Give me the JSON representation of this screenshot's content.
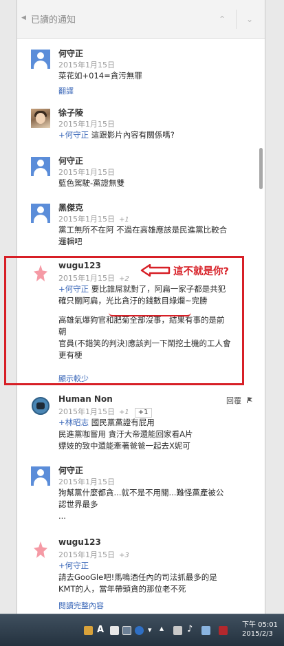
{
  "header": {
    "title": "已讀的通知"
  },
  "comments": [
    {
      "name": "何守正",
      "date": "2015年1月15日",
      "votes": "",
      "lines": [
        "菜花如+014=貪污無罪"
      ],
      "link": "翻譯"
    },
    {
      "name": "徐子陵",
      "date": "2015年1月15日",
      "mention": "+何守正",
      "lines": [
        "這跟影片內容有關係嗎?"
      ]
    },
    {
      "name": "何守正",
      "date": "2015年1月15日",
      "lines": [
        "藍色駕駛-黨證無雙"
      ]
    },
    {
      "name": "黑傑克",
      "date": "2015年1月15日",
      "votes": "+1",
      "lines": [
        "黨工無所不在阿  不過在高雄應該是民進黨比較合",
        "邏輯吧"
      ]
    },
    {
      "name": "wugu123",
      "date": "2015年1月15日",
      "votes": "+2",
      "mention": "+何守正",
      "lines": [
        "要比誰屌就對了，阿扁一家子都是共犯",
        "確只關阿扁，光比貪汙的錢數目綠爛~完勝",
        "",
        "高雄氣爆狗官和肥菊全部沒事，結果有事的是前",
        "朝",
        "官員(不錯笑的判決)應該判一下鬧挖土機的工人會",
        "更有梗"
      ],
      "link": "顯示較少"
    },
    {
      "name": "Human Non",
      "date": "",
      "reply_label": "回覆",
      "mention": "+林昭志",
      "lines": [
        "國民黨黨證有屁用",
        "民進黨咖嘗用 貪汙大帝還能回家看A片",
        "嫖妓的致中還能牽著爸爸一起去X妮可"
      ]
    },
    {
      "name": "何守正",
      "date": "2015年1月15日",
      "lines": [
        "狗幫黨什麼都貪...就不是不用關...難怪黨產被公",
        "認世界最多",
        "..."
      ]
    },
    {
      "name": "wugu123",
      "date": "2015年1月15日",
      "votes": "+3",
      "mention": "+何守正",
      "lines": [
        "請去GooGle吧!馬鳴酒任內的司法抓最多的是",
        "KMT的人，當年帶頭貪的那位老不死"
      ],
      "link": "閱讀完整內容"
    }
  ],
  "human_non_meta": {
    "date": "2015年1月15日",
    "votes": "+1",
    "votebox": "+1"
  },
  "annotation": {
    "text": "這不就是你?"
  },
  "taskbar": {
    "time": "下午 05:01",
    "date": "2015/2/3"
  },
  "colors": {
    "highlight": "#d71f26",
    "link": "#3a67b8",
    "avatar_default": "#5b8dd9"
  }
}
